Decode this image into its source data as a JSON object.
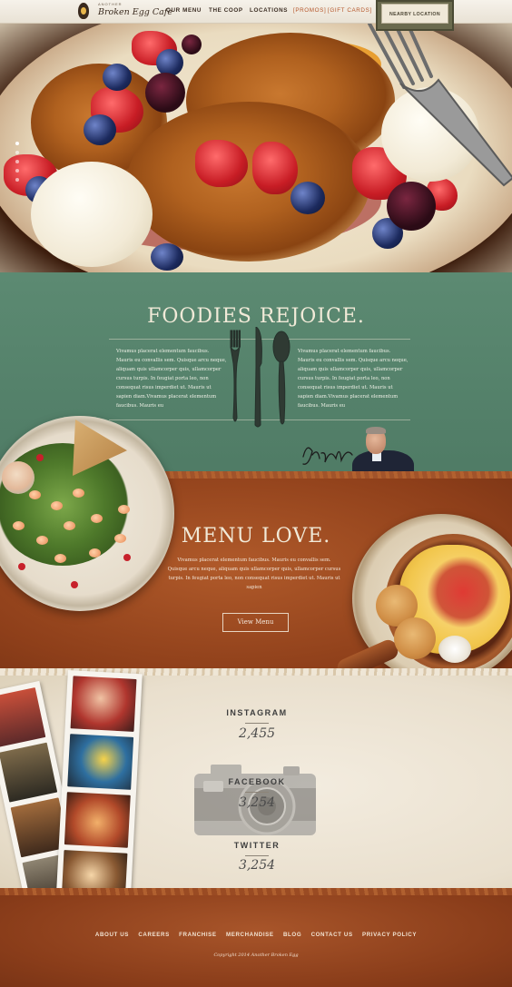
{
  "header": {
    "logo_top": "ANOTHER",
    "logo_name": "Broken Egg Cafe",
    "nav": [
      "OUR MENU",
      "THE COOP",
      "LOCATIONS"
    ],
    "nav_brackets": [
      "[PROMOS]",
      "[GIFT CARDS]"
    ],
    "nearby_label": "NEARBY LOCATION"
  },
  "hero": {
    "slides": 5,
    "active_slide": 1
  },
  "foodies": {
    "title": "FOODIES REJOICE.",
    "para_left": "Vivamus placerat elementum faucibus. Mauris eu convallis sem. Quisque arcu neque, aliquam quis ullamcorper quis, ullamcorper cursus turpis. In feugiat porta leo, non consequat risus imperdiet ut. Mauris ut sapien diam.Vivamus placerat elementum faucibus. Mauris eu",
    "para_right": "Vivamus placerat elementum faucibus. Mauris eu convallis sem. Quisque arcu neque, aliquam quis ullamcorper quis, ullamcorper cursus turpis. In feugiat porta leo, non consequat risus imperdiet ut. Mauris ut sapien diam.Vivamus placerat elementum faucibus. Mauris eu",
    "signature": "Jason Oliva"
  },
  "menu_love": {
    "title": "MENU LOVE.",
    "para": "Vivamus placerat elementum faucibus. Mauris eu convallis sem. Quisque arcu neque, aliquam quis ullamcorper quis, ullamcorper cursus turpis. In feugiat porta leo, non consequat risus imperdiet ut. Mauris ut sapien",
    "button": "View Menu"
  },
  "social": [
    {
      "label": "INSTAGRAM",
      "count": "2,455"
    },
    {
      "label": "FACEBOOK",
      "count": "3,254"
    },
    {
      "label": "TWITTER",
      "count": "3,254"
    }
  ],
  "footer": {
    "links": [
      "ABOUT US",
      "CAREERS",
      "FRANCHISE",
      "MERCHANDISE",
      "BLOG",
      "CONTACT US",
      "PRIVACY POLICY"
    ],
    "copyright": "Copyright 2014 Another Broken Egg"
  },
  "colors": {
    "green_band": "#5c8a72",
    "rust_band": "#9a4a22",
    "cream": "#efe6d6",
    "accent_orange": "#b5562a"
  }
}
